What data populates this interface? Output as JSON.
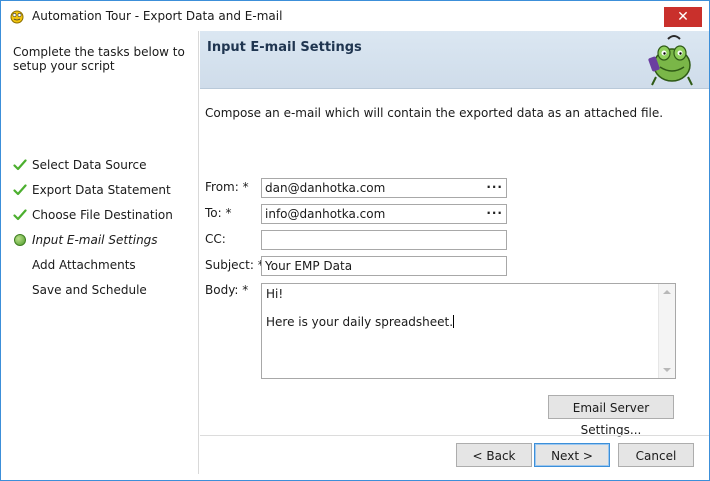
{
  "window": {
    "title": "Automation Tour - Export Data and E-mail",
    "close_glyph": "✕"
  },
  "sidebar": {
    "intro": "Complete the tasks below to setup your script",
    "steps": [
      {
        "label": "Select Data Source",
        "state": "done"
      },
      {
        "label": "Export Data Statement",
        "state": "done"
      },
      {
        "label": "Choose File Destination",
        "state": "done"
      },
      {
        "label": "Input E-mail Settings",
        "state": "current"
      },
      {
        "label": "Add Attachments",
        "state": "pending"
      },
      {
        "label": "Save and Schedule",
        "state": "pending"
      }
    ]
  },
  "header": {
    "title": "Input E-mail Settings",
    "mascot_icon": "toad-mascot-icon"
  },
  "content": {
    "description": "Compose an e-mail which will contain the exported data as an attached file."
  },
  "form": {
    "from": {
      "label": "From: *",
      "value": "dan@danhotka.com",
      "ellipsis": "···"
    },
    "to": {
      "label": "To: *",
      "value": "info@danhotka.com",
      "ellipsis": "···"
    },
    "cc": {
      "label": "CC:",
      "value": ""
    },
    "subject": {
      "label": "Subject: *",
      "value": "Your EMP Data"
    },
    "body": {
      "label": "Body: *",
      "lines": [
        "Hi!",
        "",
        "Here is your daily spreadsheet."
      ]
    }
  },
  "buttons": {
    "email_server": "Email Server Settings...",
    "back": "< Back",
    "next": "Next >",
    "cancel": "Cancel"
  },
  "colors": {
    "accent": "#3c8fd9",
    "close": "#c9302c",
    "check": "#4caf2f",
    "header_bg": "#d4e1ee"
  }
}
